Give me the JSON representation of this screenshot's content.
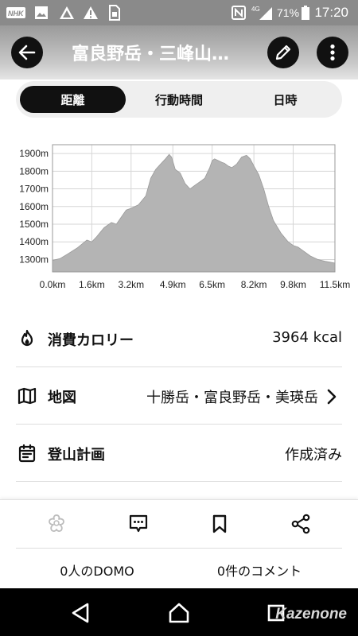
{
  "status_bar": {
    "time": "17:20",
    "battery": "71%",
    "network": "4G",
    "icons": [
      "nhk-icon",
      "image-icon",
      "signal-alert-icon",
      "warning-icon",
      "sim-icon",
      "nfc-icon",
      "signal-icon",
      "battery-icon"
    ]
  },
  "header": {
    "title": "富良野岳・三峰山…",
    "back_icon": "arrow-left-icon",
    "edit_icon": "pencil-icon",
    "menu_icon": "more-vertical-icon"
  },
  "tabs": [
    {
      "label": "距離",
      "active": true
    },
    {
      "label": "行動時間",
      "active": false
    },
    {
      "label": "日時",
      "active": false
    }
  ],
  "chart_data": {
    "type": "area",
    "title": "",
    "xlabel": "",
    "ylabel": "",
    "x_unit": "km",
    "y_unit": "m",
    "xlim": [
      0,
      11.5
    ],
    "ylim": [
      1230,
      1950
    ],
    "x_ticks": [
      "0.0km",
      "1.6km",
      "3.2km",
      "4.9km",
      "6.5km",
      "8.2km",
      "9.8km",
      "11.5km"
    ],
    "y_ticks": [
      "1300m",
      "1400m",
      "1500m",
      "1600m",
      "1700m",
      "1800m",
      "1900m"
    ],
    "grid": true,
    "fill_color": "#b4b4b4",
    "x": [
      0,
      0.3,
      0.6,
      1.0,
      1.4,
      1.6,
      1.8,
      2.1,
      2.4,
      2.6,
      2.8,
      3.0,
      3.2,
      3.5,
      3.8,
      4.0,
      4.2,
      4.4,
      4.6,
      4.75,
      4.85,
      5.0,
      5.2,
      5.4,
      5.6,
      5.8,
      6.0,
      6.2,
      6.4,
      6.5,
      6.6,
      6.75,
      6.9,
      7.0,
      7.15,
      7.3,
      7.5,
      7.7,
      7.9,
      8.05,
      8.2,
      8.4,
      8.6,
      8.8,
      9.0,
      9.3,
      9.6,
      9.8,
      10.0,
      10.2,
      10.5,
      10.8,
      11.1,
      11.3,
      11.5
    ],
    "y": [
      1295,
      1305,
      1330,
      1365,
      1410,
      1400,
      1430,
      1480,
      1510,
      1500,
      1540,
      1580,
      1590,
      1610,
      1660,
      1760,
      1810,
      1840,
      1870,
      1895,
      1880,
      1810,
      1790,
      1730,
      1700,
      1720,
      1740,
      1760,
      1820,
      1860,
      1870,
      1860,
      1850,
      1845,
      1830,
      1820,
      1840,
      1880,
      1890,
      1870,
      1830,
      1780,
      1700,
      1600,
      1520,
      1450,
      1400,
      1380,
      1370,
      1350,
      1320,
      1300,
      1290,
      1285,
      1280
    ]
  },
  "stats": {
    "calories": {
      "label": "消費カロリー",
      "value": "3964 kcal",
      "icon": "flame-icon"
    },
    "map": {
      "label": "地図",
      "value": "十勝岳・富良野岳・美瑛岳",
      "icon": "map-icon"
    },
    "plan": {
      "label": "登山計画",
      "value": "作成済み",
      "icon": "calendar-icon"
    }
  },
  "actions": {
    "domo_icon": "flower-icon",
    "comment_icon": "comment-icon",
    "bookmark_icon": "bookmark-icon",
    "share_icon": "share-icon",
    "domo_count": "0人のDOMO",
    "comment_count": "0件のコメント"
  },
  "nav": {
    "watermark": "Kazenone"
  }
}
